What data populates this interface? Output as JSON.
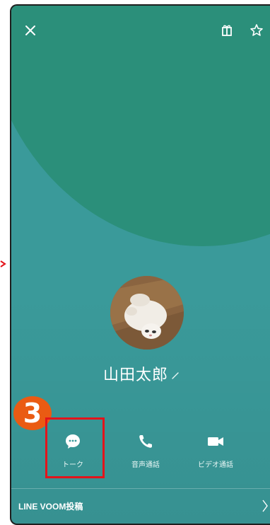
{
  "profile": {
    "name": "山田太郎"
  },
  "actions": [
    {
      "label": "トーク",
      "icon": "chat-bubble-icon"
    },
    {
      "label": "音声通話",
      "icon": "phone-icon"
    },
    {
      "label": "ビデオ通話",
      "icon": "video-camera-icon"
    }
  ],
  "header": {
    "icons": [
      "close-icon",
      "gift-icon",
      "star-icon"
    ]
  },
  "annotation": {
    "step_number": "3"
  },
  "voom": {
    "label": "LINE VOOM投稿"
  },
  "colors": {
    "background_top": "#2b8f7a",
    "background_bottom": "#3a9a9a",
    "highlight_border": "#e3141b",
    "step_badge": "#ea5b13"
  }
}
